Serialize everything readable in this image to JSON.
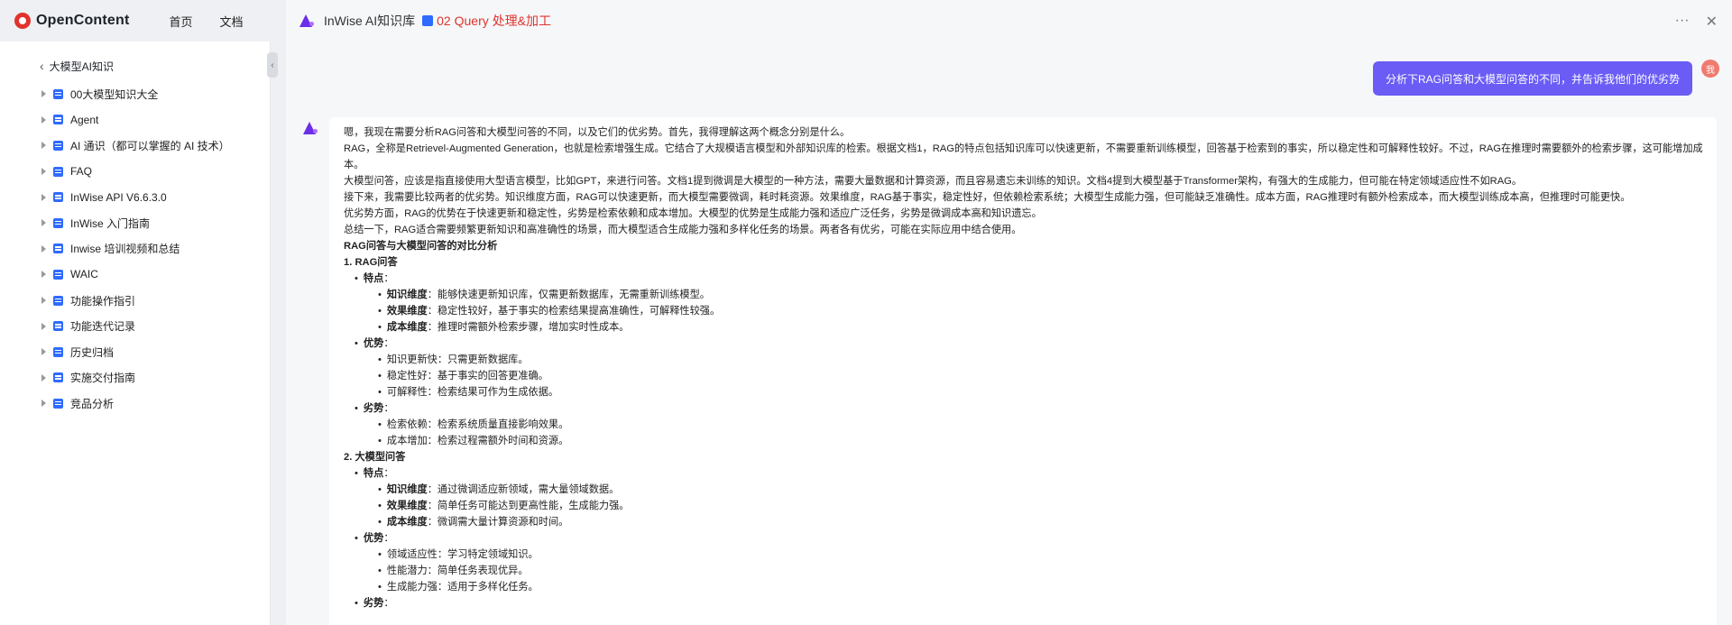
{
  "app": {
    "logo_text": "OpenContent",
    "nav": [
      "首页",
      "文档"
    ]
  },
  "sidebar": {
    "back_label": "大模型AI知识",
    "items": [
      {
        "label": "00大模型知识大全"
      },
      {
        "label": "Agent"
      },
      {
        "label": "AI 通识（都可以掌握的 AI 技术）"
      },
      {
        "label": "FAQ"
      },
      {
        "label": "InWise API V6.6.3.0"
      },
      {
        "label": "InWise 入门指南"
      },
      {
        "label": "Inwise 培训视频和总结"
      },
      {
        "label": "WAIC"
      },
      {
        "label": "功能操作指引"
      },
      {
        "label": "功能迭代记录"
      },
      {
        "label": "历史归档"
      },
      {
        "label": "实施交付指南"
      },
      {
        "label": "竞品分析"
      }
    ]
  },
  "panel": {
    "title": "InWise AI知识库",
    "crumb": "02 Query 处理&加工",
    "more_icon": "···",
    "close_icon": "✕"
  },
  "chat": {
    "user_message": "分析下RAG问答和大模型问答的不同，并告诉我他们的优劣势",
    "user_avatar": "我",
    "answer": {
      "para1": "嗯，我现在需要分析RAG问答和大模型问答的不同，以及它们的优劣势。首先，我得理解这两个概念分别是什么。",
      "para2": "RAG，全称是Retrievel-Augmented Generation，也就是检索增强生成。它结合了大规模语言模型和外部知识库的检索。根据文档1，RAG的特点包括知识库可以快速更新，不需要重新训练模型，回答基于检索到的事实，所以稳定性和可解释性较好。不过，RAG在推理时需要额外的检索步骤，这可能增加成本。",
      "para3": "大模型问答，应该是指直接使用大型语言模型，比如GPT，来进行问答。文档1提到微调是大模型的一种方法，需要大量数据和计算资源，而且容易遗忘未训练的知识。文档4提到大模型基于Transformer架构，有强大的生成能力，但可能在特定领域适应性不如RAG。",
      "para4": "接下来，我需要比较两者的优劣势。知识维度方面，RAG可以快速更新，而大模型需要微调，耗时耗资源。效果维度，RAG基于事实，稳定性好，但依赖检索系统；大模型生成能力强，但可能缺乏准确性。成本方面，RAG推理时有额外检索成本，而大模型训练成本高，但推理时可能更快。",
      "para5": "优劣势方面，RAG的优势在于快速更新和稳定性，劣势是检索依赖和成本增加。大模型的优势是生成能力强和适应广泛任务，劣势是微调成本高和知识遗忘。",
      "para6": "总结一下，RAG适合需要频繁更新知识和高准确性的场景，而大模型适合生成能力强和多样化任务的场景。两者各有优劣，可能在实际应用中结合使用。",
      "heading": "RAG问答与大模型问答的对比分析",
      "s1_title": "1. RAG问答",
      "s1_features": "特点",
      "s1_f1_k": "知识维度",
      "s1_f1_v": "：能够快速更新知识库，仅需更新数据库，无需重新训练模型。",
      "s1_f2_k": "效果维度",
      "s1_f2_v": "：稳定性较好，基于事实的检索结果提高准确性，可解释性较强。",
      "s1_f3_k": "成本维度",
      "s1_f3_v": "：推理时需额外检索步骤，增加实时性成本。",
      "s1_adv": "优势",
      "s1_a1": "知识更新快：只需更新数据库。",
      "s1_a2": "稳定性好：基于事实的回答更准确。",
      "s1_a3": "可解释性：检索结果可作为生成依据。",
      "s1_dis": "劣势",
      "s1_d1": "检索依赖：检索系统质量直接影响效果。",
      "s1_d2": "成本增加：检索过程需额外时间和资源。",
      "s2_title": "2. 大模型问答",
      "s2_features": "特点",
      "s2_f1_k": "知识维度",
      "s2_f1_v": "：通过微调适应新领域，需大量领域数据。",
      "s2_f2_k": "效果维度",
      "s2_f2_v": "：简单任务可能达到更高性能，生成能力强。",
      "s2_f3_k": "成本维度",
      "s2_f3_v": "：微调需大量计算资源和时间。",
      "s2_adv": "优势",
      "s2_a1": "领域适应性：学习特定领域知识。",
      "s2_a2": "性能潜力：简单任务表现优异。",
      "s2_a3": "生成能力强：适用于多样化任务。",
      "s2_dis": "劣势",
      "colon": "："
    }
  }
}
